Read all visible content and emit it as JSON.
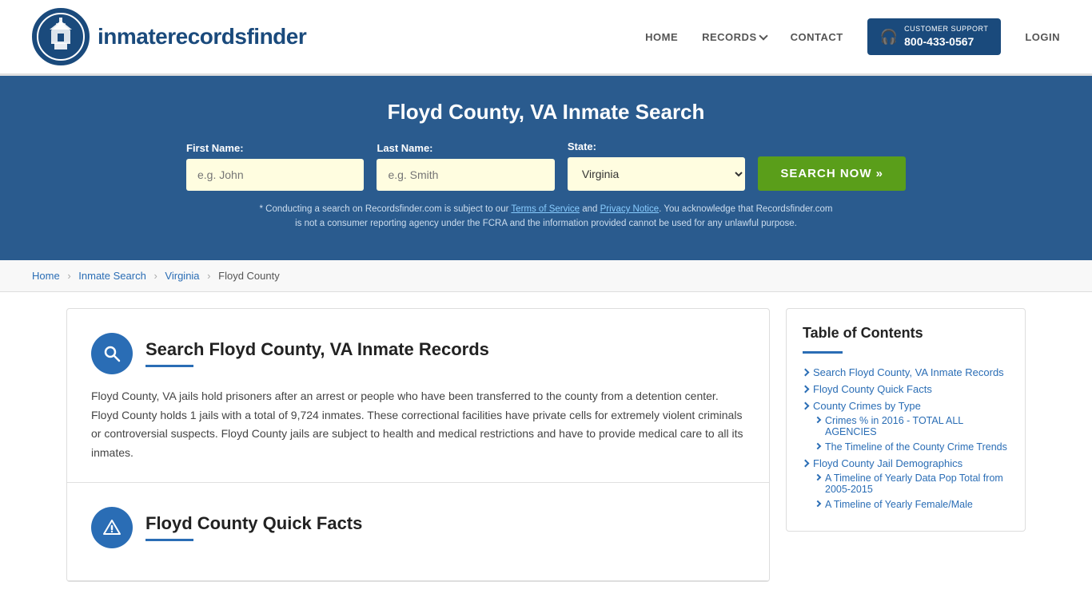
{
  "header": {
    "logo_text_regular": "inmaterecords",
    "logo_text_bold": "finder",
    "nav": {
      "home_label": "HOME",
      "records_label": "RECORDS",
      "contact_label": "CONTACT",
      "support_label": "CUSTOMER SUPPORT",
      "support_number": "800-433-0567",
      "login_label": "LOGIN"
    }
  },
  "hero": {
    "title": "Floyd County, VA Inmate Search",
    "first_name_label": "First Name:",
    "first_name_placeholder": "e.g. John",
    "last_name_label": "Last Name:",
    "last_name_placeholder": "e.g. Smith",
    "state_label": "State:",
    "state_value": "Virginia",
    "search_button": "SEARCH NOW »",
    "disclaimer_line1": "* Conducting a search on Recordsfinder.com is subject to our Terms of Service and Privacy Notice. You acknowledge that Recordsfinder.com",
    "disclaimer_line2": "is not a consumer reporting agency under the FCRA and the information provided cannot be used for any unlawful purpose.",
    "terms_text": "Terms of Service",
    "privacy_text": "Privacy Notice"
  },
  "breadcrumb": {
    "home": "Home",
    "inmate_search": "Inmate Search",
    "virginia": "Virginia",
    "floyd_county": "Floyd County"
  },
  "sections": [
    {
      "id": "search-section",
      "title": "Search Floyd County, VA Inmate Records",
      "body": "Floyd County, VA jails hold prisoners after an arrest or people who have been transferred to the county from a detention center. Floyd County holds 1 jails with a total of 9,724 inmates. These correctional facilities have private cells for extremely violent criminals or controversial suspects. Floyd County jails are subject to health and medical restrictions and have to provide medical care to all its inmates.",
      "icon": "search"
    },
    {
      "id": "quick-facts-section",
      "title": "Floyd County Quick Facts",
      "body": "",
      "icon": "alert"
    }
  ],
  "toc": {
    "title": "Table of Contents",
    "items": [
      {
        "label": "Search Floyd County, VA Inmate Records",
        "sub": []
      },
      {
        "label": "Floyd County Quick Facts",
        "sub": []
      },
      {
        "label": "County Crimes by Type",
        "sub": [
          "Crimes % in 2016 - TOTAL ALL AGENCIES",
          "The Timeline of the County Crime Trends"
        ]
      },
      {
        "label": "Floyd County Jail Demographics",
        "sub": [
          "A Timeline of Yearly Data Pop Total from 2005-2015",
          "A Timeline of Yearly Female/Male"
        ]
      }
    ]
  }
}
